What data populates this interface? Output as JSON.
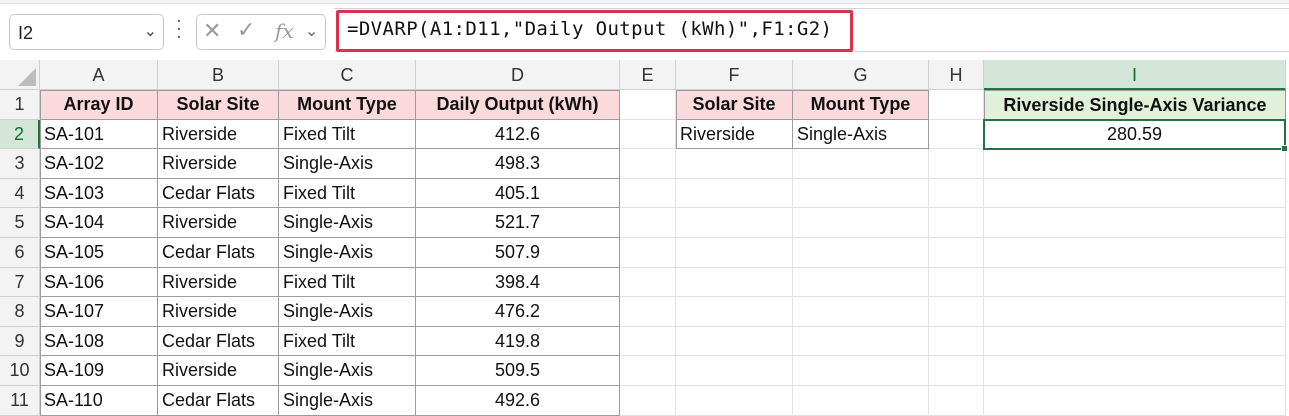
{
  "name_box": {
    "value": "I2"
  },
  "formula_bar": {
    "formula": "=DVARP(A1:D11,\"Daily Output (kWh)\",F1:G2)",
    "cancel_glyph": "✕",
    "enter_glyph": "✓",
    "fx_glyph": "fx"
  },
  "columns": [
    "A",
    "B",
    "C",
    "D",
    "E",
    "F",
    "G",
    "H",
    "I"
  ],
  "rows": [
    "1",
    "2",
    "3",
    "4",
    "5",
    "6",
    "7",
    "8",
    "9",
    "10",
    "11"
  ],
  "table": {
    "headers": [
      "Array ID",
      "Solar Site",
      "Mount Type",
      "Daily Output (kWh)"
    ],
    "rows": [
      [
        "SA-101",
        "Riverside",
        "Fixed Tilt",
        "412.6"
      ],
      [
        "SA-102",
        "Riverside",
        "Single-Axis",
        "498.3"
      ],
      [
        "SA-103",
        "Cedar Flats",
        "Fixed Tilt",
        "405.1"
      ],
      [
        "SA-104",
        "Riverside",
        "Single-Axis",
        "521.7"
      ],
      [
        "SA-105",
        "Cedar Flats",
        "Single-Axis",
        "507.9"
      ],
      [
        "SA-106",
        "Riverside",
        "Fixed Tilt",
        "398.4"
      ],
      [
        "SA-107",
        "Riverside",
        "Single-Axis",
        "476.2"
      ],
      [
        "SA-108",
        "Cedar Flats",
        "Fixed Tilt",
        "419.8"
      ],
      [
        "SA-109",
        "Riverside",
        "Single-Axis",
        "509.5"
      ],
      [
        "SA-110",
        "Cedar Flats",
        "Single-Axis",
        "492.6"
      ]
    ]
  },
  "criteria": {
    "headers": [
      "Solar Site",
      "Mount Type"
    ],
    "values": [
      "Riverside",
      "Single-Axis"
    ]
  },
  "result": {
    "header": "Riverside Single-Axis Variance",
    "value": "280.59"
  },
  "colors": {
    "accent_green": "#217346",
    "formula_highlight": "#d9334e",
    "table_header_fill": "#fadadd",
    "result_header_fill": "#e2efd9"
  },
  "selected_cell": "I2"
}
